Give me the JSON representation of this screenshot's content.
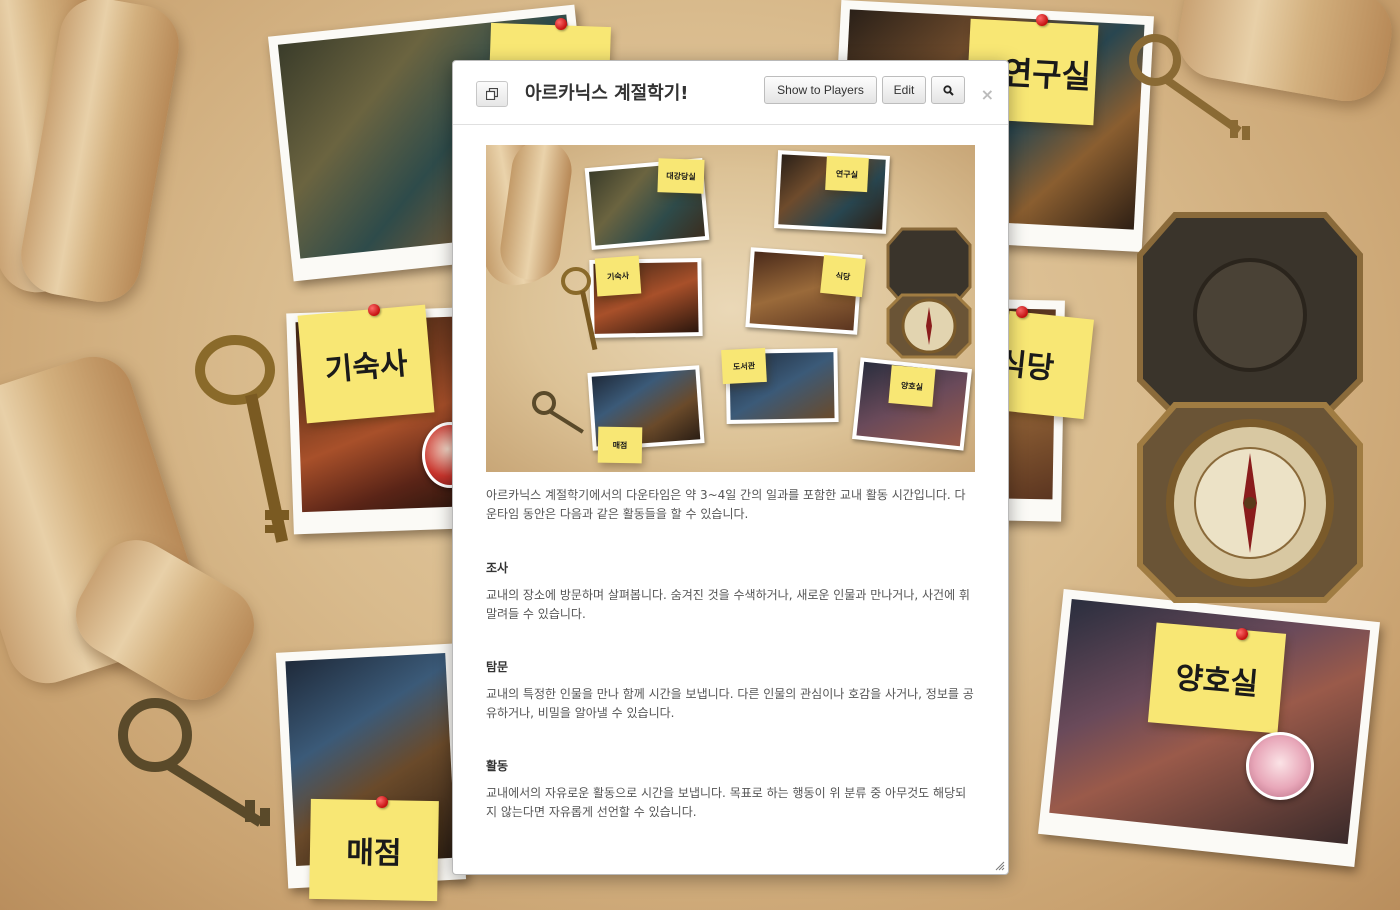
{
  "background": {
    "notes": [
      "기숙사",
      "매점",
      "연구실",
      "식당",
      "양호실"
    ],
    "colors": {
      "note": "#f8e774",
      "pin": "#d21616",
      "parchment": "#d9bb8d"
    }
  },
  "dialog": {
    "title": "아르카닉스 계절학기!",
    "buttons": {
      "show_to_players": "Show to Players",
      "edit": "Edit"
    },
    "icons": {
      "popout": "popout-icon",
      "search": "search-icon",
      "close": "close-icon"
    },
    "close_glyph": "×",
    "hero_labels": [
      "대강당실",
      "연구실",
      "기숙사",
      "식당",
      "도서관",
      "양호실",
      "매점"
    ],
    "intro": "아르카닉스 계절학기에서의 다운타임은 약 3~4일 간의 일과를 포함한 교내 활동 시간입니다. 다운타임 동안은 다음과 같은 활동들을 할 수 있습니다.",
    "sections": [
      {
        "heading": "조사",
        "text": "교내의 장소에 방문하며 살펴봅니다. 숨겨진 것을 수색하거나, 새로운 인물과 만나거나, 사건에 휘말려들 수 있습니다."
      },
      {
        "heading": "탐문",
        "text": "교내의 특정한 인물을 만나 함께 시간을 보냅니다. 다른 인물의 관심이나 호감을 사거나, 정보를 공유하거나, 비밀을 알아낼 수 있습니다."
      },
      {
        "heading": "활동",
        "text": "교내에서의 자유로운 활동으로 시간을 보냅니다. 목표로 하는 행동이 위 분류 중 아무것도 해당되지 않는다면 자유롭게 선언할 수 있습니다."
      }
    ]
  }
}
